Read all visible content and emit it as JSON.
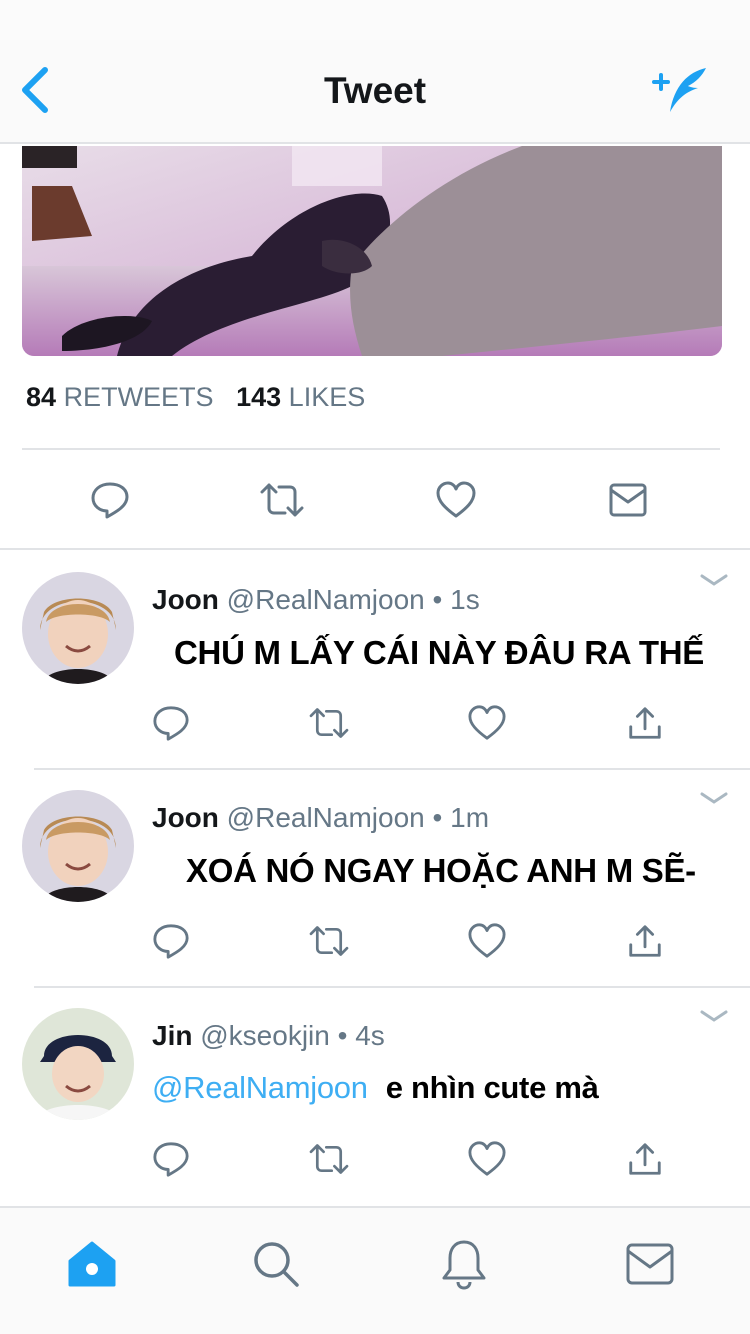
{
  "colors": {
    "accent": "#1da1f2",
    "icon_gray": "#657786",
    "text": "#14171a",
    "divider": "#e1e3e6"
  },
  "header": {
    "title": "Tweet",
    "back_icon": "chevron-left-icon",
    "compose_icon": "compose-feather-icon"
  },
  "tweet": {
    "retweets_count": "84",
    "retweets_label": "RETWEETS",
    "likes_count": "143",
    "likes_label": "LIKES",
    "actions": [
      "reply-icon",
      "retweet-icon",
      "like-icon",
      "direct-message-icon"
    ]
  },
  "replies": [
    {
      "name": "Joon",
      "handle": "@RealNamjoon",
      "separator": "•",
      "time": "1s",
      "mention": "",
      "text": "CHÚ M LẤY CÁI NÀY ĐÂU RA THẾ"
    },
    {
      "name": "Joon",
      "handle": "@RealNamjoon",
      "separator": "•",
      "time": "1m",
      "mention": "",
      "text": "XOÁ NÓ NGAY HOẶC ANH M SẼ-"
    },
    {
      "name": "Jin",
      "handle": "@kseokjin",
      "separator": "•",
      "time": "4s",
      "mention": "@RealNamjoon",
      "text": "e nhìn cute mà"
    }
  ],
  "tabbar": {
    "tabs": [
      "home-icon",
      "search-icon",
      "notifications-bell-icon",
      "messages-icon"
    ],
    "active": "home-icon"
  }
}
